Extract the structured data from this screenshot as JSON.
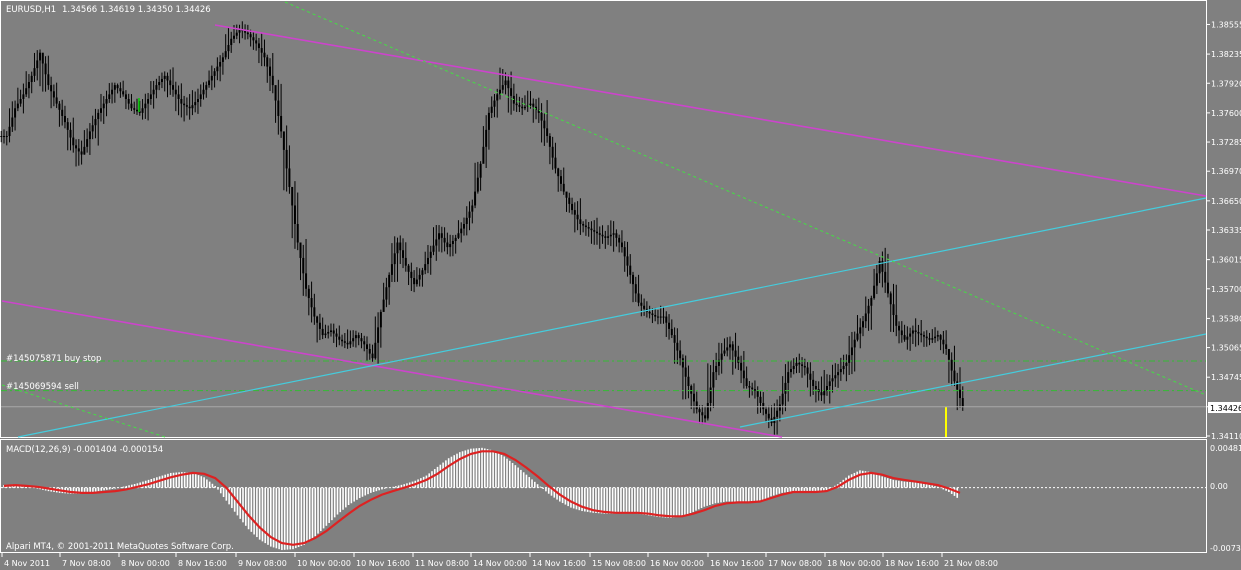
{
  "header": {
    "symbol": "EURUSD,H1",
    "ohlc": "1.34566 1.34619 1.34350 1.34426"
  },
  "orders": [
    {
      "label": "#145075871 buy stop",
      "price": 1.3492
    },
    {
      "label": "#145069594 sell",
      "price": 1.346
    }
  ],
  "current_price_label": "1.34426",
  "macd": {
    "title": "MACD(12,26,9) -0.001404 -0.000154",
    "ticks": [
      "0.00481",
      "0.00",
      "-0.00731"
    ]
  },
  "footer": {
    "copyright": "Alpari MT4, © 2001-2011 MetaQuotes Software Corp."
  },
  "colors": {
    "background": "#808080",
    "candle": "#000000",
    "up_candle_accent": "#00cc00",
    "trend_magenta": "#cc44cc",
    "trend_cyan": "#44ccdd",
    "trend_green_dotted": "#44dd44",
    "order_line": "#33bb33",
    "macd_hist": "#ffffff",
    "macd_signal": "#dd2222",
    "zero_line": "#ffffff",
    "current_bar": "#ffff00"
  },
  "chart_data": [
    {
      "type": "line",
      "title": "EURUSD,H1",
      "ylim": [
        1.3411,
        1.3856
      ],
      "y_ticks": [
        "1.38555",
        "1.38235",
        "1.37920",
        "1.37600",
        "1.37285",
        "1.36970",
        "1.36650",
        "1.36335",
        "1.36015",
        "1.35700",
        "1.35380",
        "1.35065",
        "1.34745",
        "1.34426",
        "1.34110"
      ],
      "x_ticks": [
        "4 Nov 2011",
        "7 Nov 08:00",
        "8 Nov 00:00",
        "8 Nov 16:00",
        "9 Nov 08:00",
        "10 Nov 00:00",
        "10 Nov 16:00",
        "11 Nov 08:00",
        "14 Nov 00:00",
        "14 Nov 16:00",
        "15 Nov 08:00",
        "16 Nov 00:00",
        "16 Nov 16:00",
        "17 Nov 08:00",
        "18 Nov 00:00",
        "18 Nov 16:00",
        "21 Nov 08:00"
      ],
      "series": [
        {
          "name": "EURUSD,H1",
          "values": [
            1.3735,
            1.3765,
            1.378,
            1.38,
            1.3825,
            1.379,
            1.377,
            1.375,
            1.3725,
            1.3715,
            1.374,
            1.376,
            1.3775,
            1.379,
            1.378,
            1.3765,
            1.376,
            1.3775,
            1.379,
            1.38,
            1.3785,
            1.377,
            1.3765,
            1.3775,
            1.379,
            1.3805,
            1.382,
            1.384,
            1.385,
            1.3845,
            1.3835,
            1.382,
            1.379,
            1.374,
            1.368,
            1.362,
            1.357,
            1.354,
            1.352,
            1.3525,
            1.3515,
            1.351,
            1.352,
            1.351,
            1.3495,
            1.3545,
            1.3585,
            1.362,
            1.3595,
            1.3575,
            1.359,
            1.361,
            1.363,
            1.3615,
            1.3625,
            1.364,
            1.366,
            1.3705,
            1.376,
            1.378,
            1.3795,
            1.377,
            1.3765,
            1.377,
            1.376,
            1.3735,
            1.37,
            1.3675,
            1.3655,
            1.364,
            1.3635,
            1.363,
            1.3625,
            1.363,
            1.3615,
            1.3585,
            1.3555,
            1.3545,
            1.354,
            1.354,
            1.352,
            1.3495,
            1.3465,
            1.344,
            1.343,
            1.348,
            1.35,
            1.351,
            1.349,
            1.3465,
            1.346,
            1.344,
            1.3425,
            1.3445,
            1.348,
            1.349,
            1.3485,
            1.3465,
            1.3455,
            1.347,
            1.348,
            1.349,
            1.3515,
            1.3535,
            1.356,
            1.36,
            1.3565,
            1.353,
            1.3515,
            1.3525,
            1.352,
            1.3515,
            1.352,
            1.3505,
            1.347,
            1.3443
          ]
        }
      ]
    },
    {
      "type": "bar",
      "title": "MACD(12,26,9) -0.001404 -0.000154",
      "ylim": [
        -0.00731,
        0.00481
      ],
      "series": [
        {
          "name": "MACD",
          "values": [
            0.0003,
            0.0004,
            0.0002,
            -0.0001,
            -0.0004,
            -0.0006,
            -0.0007,
            -0.0007,
            -0.0005,
            -0.0003,
            -0.0001,
            0.0002,
            0.0005,
            0.0009,
            0.0013,
            0.0017,
            0.0018,
            0.0017,
            0.0012,
            0.0002,
            -0.0015,
            -0.0032,
            -0.0048,
            -0.006,
            -0.0068,
            -0.0072,
            -0.0071,
            -0.0066,
            -0.0056,
            -0.0044,
            -0.0031,
            -0.002,
            -0.0012,
            -0.0006,
            -0.0002,
            0.0001,
            0.0004,
            0.0008,
            0.0014,
            0.0024,
            0.0034,
            0.0041,
            0.0045,
            0.0046,
            0.0043,
            0.0036,
            0.0026,
            0.0015,
            0.0004,
            -0.0007,
            -0.0016,
            -0.0023,
            -0.0027,
            -0.0029,
            -0.003,
            -0.003,
            -0.0029,
            -0.003,
            -0.0032,
            -0.0034,
            -0.0035,
            -0.0033,
            -0.0028,
            -0.0022,
            -0.0018,
            -0.0016,
            -0.0016,
            -0.0018,
            -0.0016,
            -0.001,
            -0.0006,
            -0.0004,
            -0.0005,
            -0.0006,
            -0.0003,
            0.0004,
            0.0014,
            0.002,
            0.0018,
            0.0013,
            0.0009,
            0.0007,
            0.0006,
            0.0004,
            0.0001,
            -0.0005,
            -0.0014
          ]
        },
        {
          "name": "Signal",
          "values": [
            0.0002,
            0.0003,
            0.0002,
            0.0001,
            -0.0001,
            -0.0003,
            -0.0005,
            -0.0006,
            -0.0006,
            -0.0005,
            -0.0004,
            -0.0002,
            0.0001,
            0.0004,
            0.0008,
            0.0012,
            0.0015,
            0.0017,
            0.0016,
            0.0011,
            0.0,
            -0.0016,
            -0.0032,
            -0.0046,
            -0.0057,
            -0.0064,
            -0.0066,
            -0.0064,
            -0.0058,
            -0.005,
            -0.004,
            -0.003,
            -0.0021,
            -0.0014,
            -0.0008,
            -0.0004,
            0.0,
            0.0004,
            0.0009,
            0.0016,
            0.0025,
            0.0033,
            0.0039,
            0.0042,
            0.0042,
            0.0039,
            0.0032,
            0.0023,
            0.0013,
            0.0002,
            -0.0008,
            -0.0016,
            -0.0022,
            -0.0026,
            -0.0028,
            -0.0029,
            -0.0029,
            -0.0029,
            -0.003,
            -0.0032,
            -0.0033,
            -0.0033,
            -0.003,
            -0.0026,
            -0.0021,
            -0.0018,
            -0.0017,
            -0.0017,
            -0.0016,
            -0.0012,
            -0.0008,
            -0.0005,
            -0.0005,
            -0.0005,
            -0.0004,
            0.0001,
            0.0009,
            0.0015,
            0.0017,
            0.0015,
            0.0011,
            0.0009,
            0.0007,
            0.0005,
            0.0003,
            -0.0001,
            -0.0006
          ]
        }
      ]
    }
  ]
}
